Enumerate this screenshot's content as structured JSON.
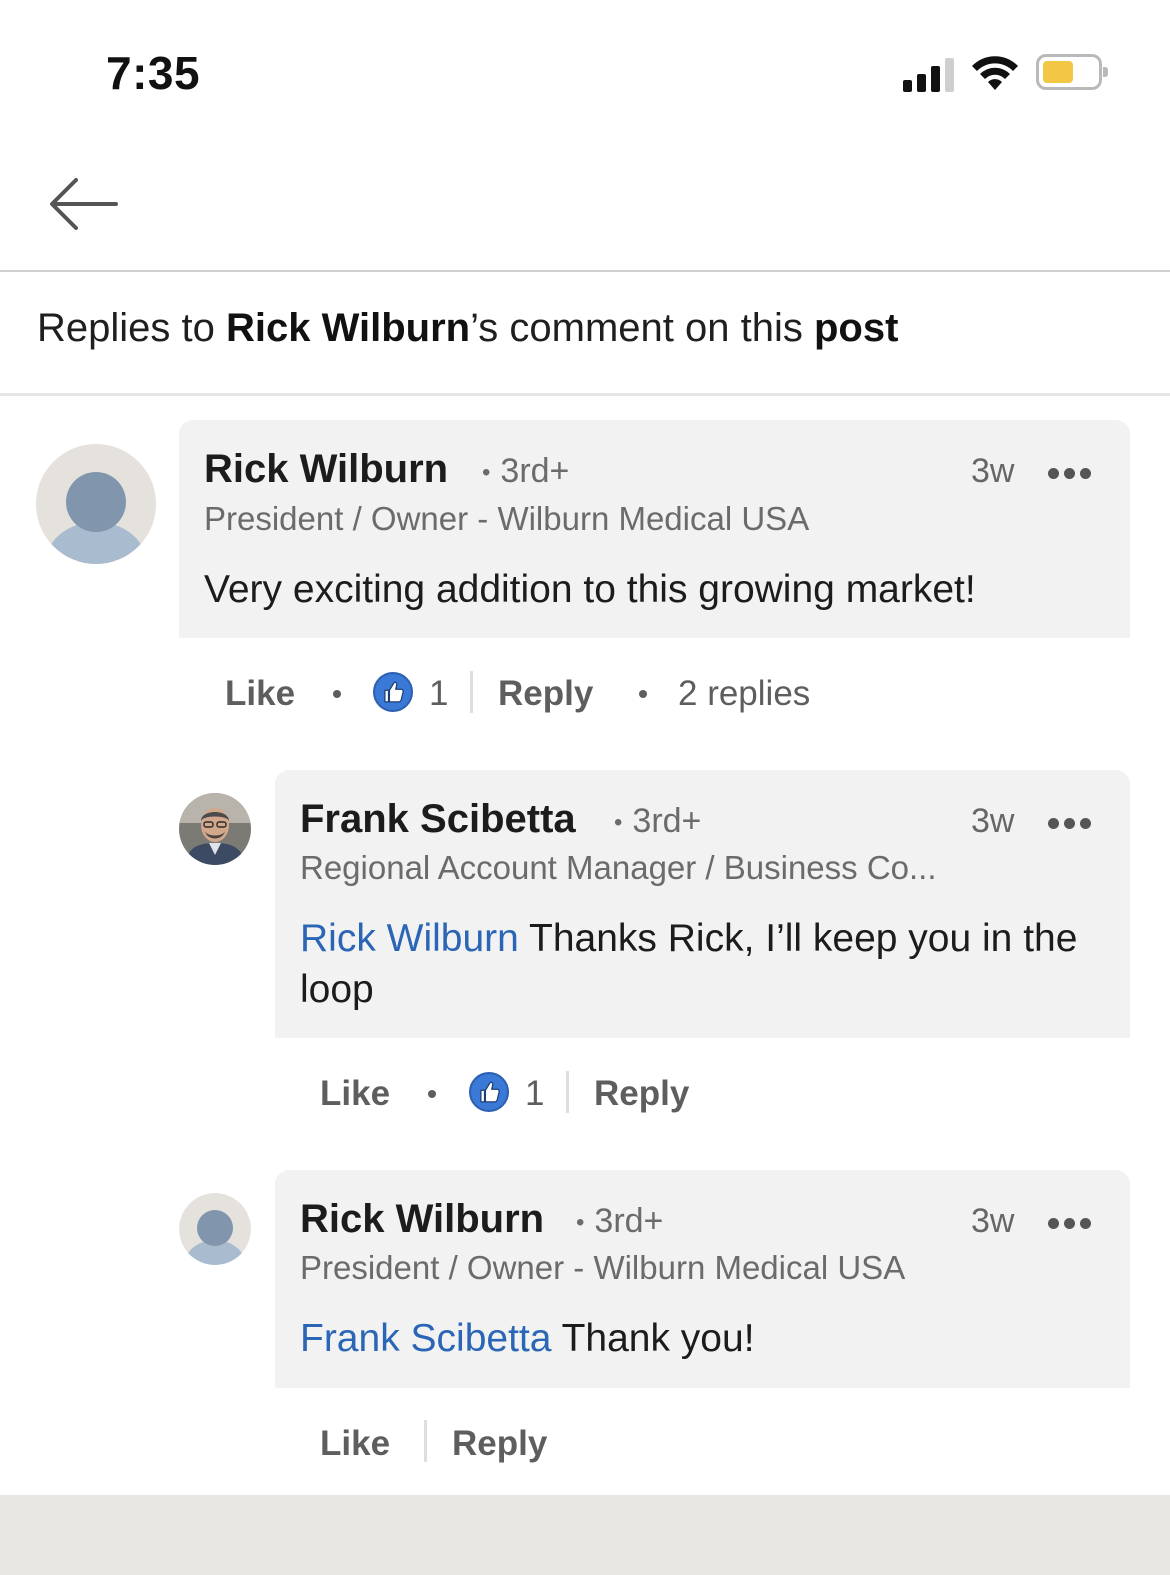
{
  "status_bar": {
    "time": "7:35"
  },
  "header": {
    "heading": {
      "prefix": "Replies to ",
      "author": "Rick Wilburn",
      "middle": "’s comment on this ",
      "post": "post"
    }
  },
  "comments": [
    {
      "author": "Rick Wilburn",
      "degree": "3rd+",
      "time": "3w",
      "headline": "President / Owner - Wilburn Medical USA",
      "text": "Very exciting addition to this growing market!",
      "actions": {
        "like": "Like",
        "like_count": "1",
        "reply": "Reply",
        "replies": "2 replies"
      }
    },
    {
      "author": "Frank Scibetta",
      "degree": "3rd+",
      "time": "3w",
      "headline": "Regional Account Manager / Business Co...",
      "mention": "Rick Wilburn",
      "text": " Thanks Rick, I’ll keep you in the loop",
      "actions": {
        "like": "Like",
        "like_count": "1",
        "reply": "Reply"
      }
    },
    {
      "author": "Rick Wilburn",
      "degree": "3rd+",
      "time": "3w",
      "headline": "President / Owner - Wilburn Medical USA",
      "mention": "Frank Scibetta",
      "text": " Thank you!",
      "actions": {
        "like": "Like",
        "reply": "Reply"
      }
    }
  ],
  "icons": {
    "back": "back-arrow-icon",
    "more": "more-options-icon",
    "like": "thumbs-up-icon",
    "signal": "cellular-signal-icon",
    "wifi": "wifi-icon",
    "battery": "battery-icon"
  },
  "colors": {
    "link": "#2a66b5",
    "like_badge": "#3b79d6",
    "bubble": "#f2f2f2",
    "battery_fill": "#f2c744"
  }
}
